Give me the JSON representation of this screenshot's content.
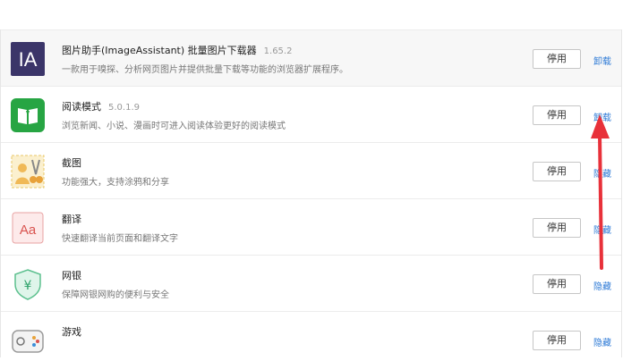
{
  "extensions": [
    {
      "name": "图片助手(ImageAssistant) 批量图片下载器",
      "version": "1.65.2",
      "desc": "一款用于嗅探、分析网页图片并提供批量下载等功能的浏览器扩展程序。",
      "button": "停用",
      "link": "卸载",
      "icon": "ia-logo-icon"
    },
    {
      "name": "阅读模式",
      "version": "5.0.1.9",
      "desc": "浏览新闻、小说、漫画时可进入阅读体验更好的阅读模式",
      "button": "停用",
      "link": "卸载",
      "icon": "book-icon"
    },
    {
      "name": "截图",
      "version": "",
      "desc": "功能强大，支持涂鸦和分享",
      "button": "停用",
      "link": "隐藏",
      "icon": "scissors-icon"
    },
    {
      "name": "翻译",
      "version": "",
      "desc": "快速翻译当前页面和翻译文字",
      "button": "停用",
      "link": "隐藏",
      "icon": "translate-icon"
    },
    {
      "name": "网银",
      "version": "",
      "desc": "保障网银网购的便利与安全",
      "button": "停用",
      "link": "隐藏",
      "icon": "shield-yen-icon"
    },
    {
      "name": "游戏",
      "version": "",
      "desc": "",
      "button": "停用",
      "link": "隐藏",
      "icon": "gamepad-icon"
    }
  ],
  "colors": {
    "link": "#2d7ad6",
    "arrow": "#e8313a",
    "ia": "#3b3569",
    "reader": "#27a543"
  }
}
